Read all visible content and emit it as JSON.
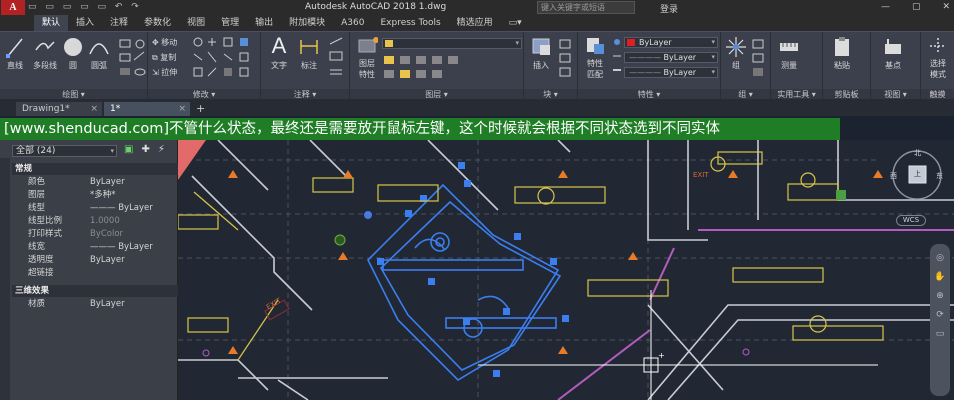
{
  "titlebar": {
    "logo": "A",
    "quick_tools": "▭ ▭ ▭ ▭ ▭ ↶ ↷",
    "title": "Autodesk AutoCAD 2018    1.dwg",
    "search_placeholder": "键入关键字或短语",
    "login": "登录",
    "window_buttons": [
      "—",
      "▢",
      "✕"
    ]
  },
  "tabs": [
    "默认",
    "插入",
    "注释",
    "参数化",
    "视图",
    "管理",
    "输出",
    "附加模块",
    "A360",
    "Express Tools",
    "精选应用",
    "▭▾"
  ],
  "ribbon": {
    "draw": {
      "title": "绘图 ▾",
      "line": "直线",
      "polyline": "多段线",
      "circle": "圆",
      "arc": "圆弧"
    },
    "modify": {
      "title": "修改 ▾",
      "move": "移动",
      "copy": "复制",
      "stretch": "拉伸"
    },
    "annotation": {
      "title": "注释 ▾",
      "text": "文字",
      "dimension": "标注"
    },
    "layers": {
      "title": "图层 ▾",
      "layer_props": "图层\n特性"
    },
    "block": {
      "title": "块 ▾",
      "insert": "插入"
    },
    "properties": {
      "title": "特性 ▾",
      "match": "特性\n匹配",
      "color_value": "ByLayer",
      "linetype_value": "ByLayer",
      "lineweight_value": "ByLayer",
      "color_swatch": "#e02020"
    },
    "groups": {
      "title": "组 ▾",
      "group": "组"
    },
    "utilities": {
      "title": "实用工具 ▾",
      "measure": "测量"
    },
    "clipboard": {
      "title": "剪贴板",
      "paste": "粘贴"
    },
    "view": {
      "title": "视图 ▾",
      "base": "基点"
    },
    "touch": {
      "title": "触摸",
      "select_mode": "选择\n模式"
    }
  },
  "doc_tabs": [
    {
      "label": "Drawing1*",
      "close": "×"
    },
    {
      "label": "1*",
      "close": "×"
    }
  ],
  "doc_plus": "+",
  "banner": "[www.shenducad.com]不管什么状态，最终还是需要放开鼠标左键，这个时候就会根据不同状态选到不同实体",
  "properties_palette": {
    "selection": "全部 (24)",
    "sections": {
      "general": "常规",
      "three_d": "三维效果"
    },
    "general_rows": [
      {
        "key": "颜色",
        "value": "ByLayer",
        "dim": false
      },
      {
        "key": "图层",
        "value": "*多种*",
        "dim": false
      },
      {
        "key": "线型",
        "value": "——— ByLayer",
        "dim": false
      },
      {
        "key": "线型比例",
        "value": "1.0000",
        "dim": true
      },
      {
        "key": "打印样式",
        "value": "ByColor",
        "dim": true
      },
      {
        "key": "线宽",
        "value": "——— ByLayer",
        "dim": false
      },
      {
        "key": "透明度",
        "value": "ByLayer",
        "dim": false
      },
      {
        "key": "超链接",
        "value": "",
        "dim": false
      }
    ],
    "three_d_rows": [
      {
        "key": "材质",
        "value": "ByLayer",
        "dim": false
      }
    ]
  },
  "canvas": {
    "viewcube": {
      "top": "上",
      "west": "西",
      "east": "东",
      "north": "北"
    },
    "wcs": "WCS",
    "exit_labels": [
      "EXIT",
      "EXIT"
    ]
  }
}
